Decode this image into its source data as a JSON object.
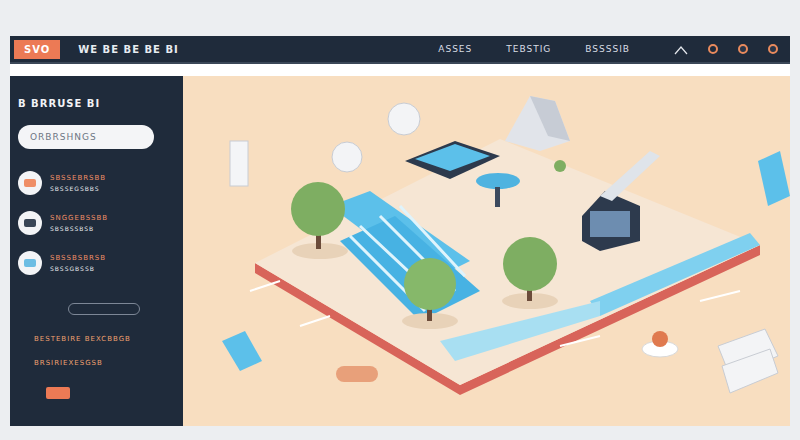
{
  "header": {
    "logo": "SVO",
    "brand": "WE BE BE BE BI",
    "nav": [
      "ASSES",
      "TEBSTIG",
      "BSSSSIB"
    ]
  },
  "sidebar": {
    "title": "B BRRUSE BI",
    "search": {
      "placeholder": "ORBRSHNGS"
    },
    "items": [
      {
        "title": "SBSSEBRSBB",
        "subtitle": "SBSSEGSBBS"
      },
      {
        "title": "SNGGEBSSBB",
        "subtitle": "SBSBSSBSB"
      },
      {
        "title": "SBSSBSBRSB",
        "subtitle": "SBSSGBSSB"
      }
    ],
    "links": [
      "BESTEBIRE BEXCBBGB",
      "BRSIRIEXESGSB"
    ]
  }
}
